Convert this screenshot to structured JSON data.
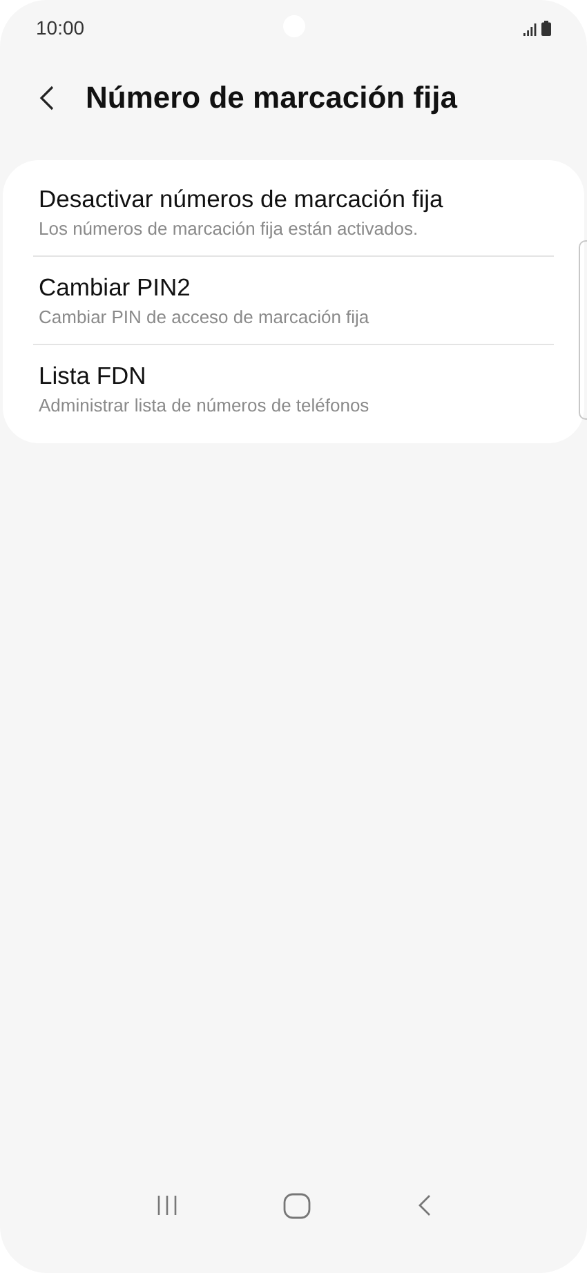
{
  "status_bar": {
    "time": "10:00"
  },
  "header": {
    "title": "Número de marcación fija"
  },
  "items": [
    {
      "title": "Desactivar números de marcación fija",
      "subtitle": "Los números de marcación fija están activados."
    },
    {
      "title": "Cambiar PIN2",
      "subtitle": "Cambiar PIN de acceso de marcación fija"
    },
    {
      "title": "Lista FDN",
      "subtitle": "Administrar lista de números de teléfonos"
    }
  ]
}
